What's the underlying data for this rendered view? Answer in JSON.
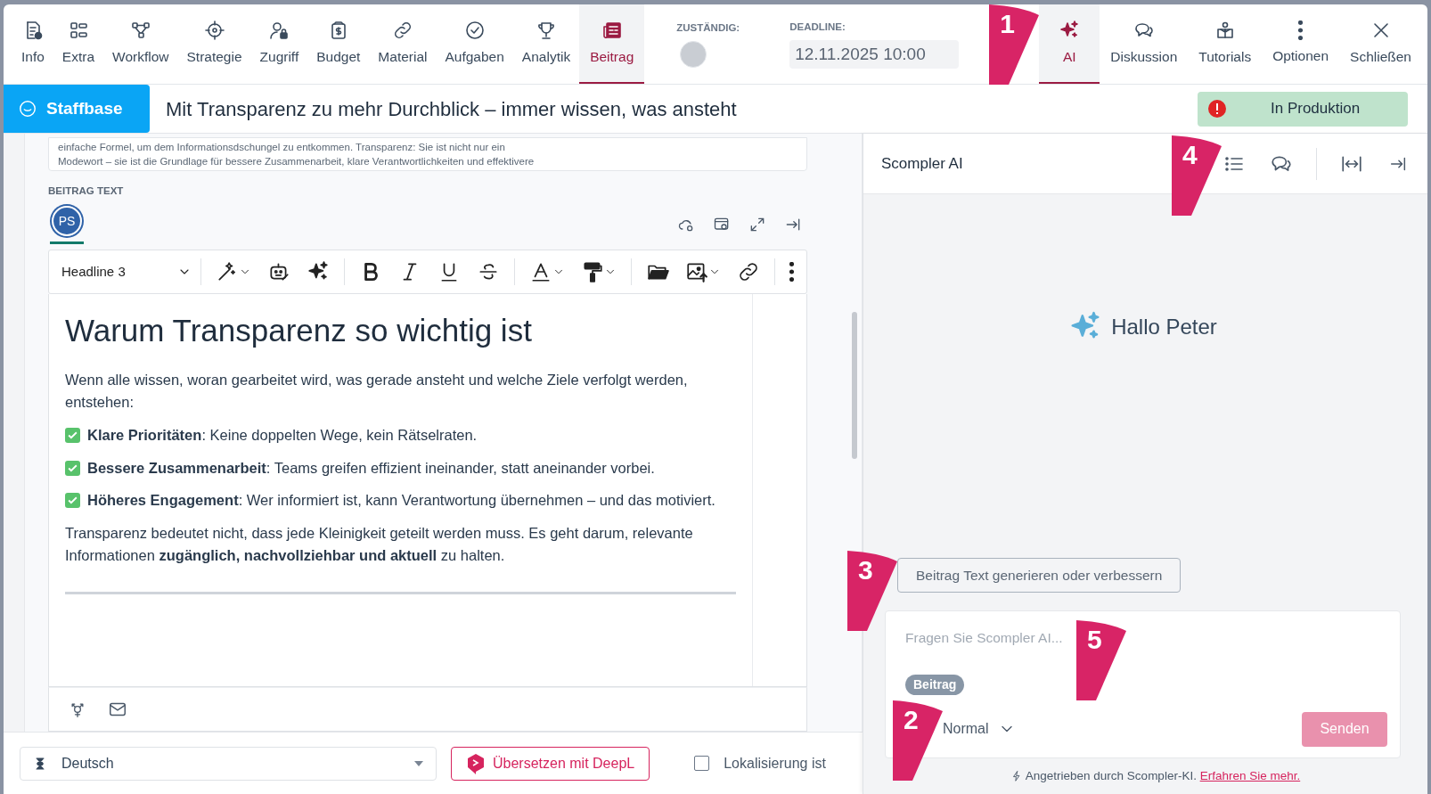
{
  "nav_tabs": [
    {
      "label": "Info",
      "selected": false
    },
    {
      "label": "Extra",
      "selected": false
    },
    {
      "label": "Workflow",
      "selected": false
    },
    {
      "label": "Strategie",
      "selected": false
    },
    {
      "label": "Zugriff",
      "selected": false
    },
    {
      "label": "Budget",
      "selected": false
    },
    {
      "label": "Material",
      "selected": false
    },
    {
      "label": "Aufgaben",
      "selected": false
    },
    {
      "label": "Analytik",
      "selected": false
    },
    {
      "label": "Beitrag",
      "selected": true
    }
  ],
  "assignee": {
    "label": "ZUSTÄNDIG:"
  },
  "deadline": {
    "label": "DEADLINE:",
    "value": "12.11.2025 10:00"
  },
  "right_tabs": [
    {
      "label": "AI",
      "selected": true
    },
    {
      "label": "Diskussion",
      "selected": false
    },
    {
      "label": "Tutorials",
      "selected": false
    },
    {
      "label": "Optionen",
      "selected": false
    },
    {
      "label": "Schließen",
      "selected": false
    }
  ],
  "brand": "Staffbase",
  "title": "Mit Transparenz zu mehr Durchblick – immer wissen, was ansteht",
  "status": "In Produktion",
  "excerpt_lines": [
    "einfache Formel, um dem Informationsdschungel zu entkommen. Transparenz: Sie ist nicht nur ein",
    "Modewort – sie ist die Grundlage für bessere Zusammenarbeit, klare Verantwortlichkeiten und effektivere"
  ],
  "editor": {
    "label": "BEITRAG TEXT",
    "avatar": "PS",
    "format": "Headline 3",
    "heading": "Warum Transparenz so wichtig ist",
    "intro": "Wenn alle wissen, woran gearbeitet wird, was gerade ansteht und welche Ziele verfolgt werden, entstehen:",
    "checklist": [
      {
        "text": "**Klare Prioritäten**: Keine doppelten Wege, kein Rätselraten.",
        "checked": true
      },
      {
        "text": "**Bessere Zusammenarbeit**: Teams greifen effizient ineinander, statt aneinander vorbei.",
        "checked": true
      },
      {
        "text": "**Höheres Engagement**: Wer informiert ist, kann Verantwortung übernehmen – und das motiviert.",
        "checked": true
      }
    ],
    "closing": "Transparenz bedeutet nicht, dass jede Kleinigkeit geteilt werden muss. Es geht darum, relevante Informationen **zugänglich, nachvollziehbar und aktuell** zu halten."
  },
  "footer": {
    "language": "Deutsch",
    "translate_button": "Übersetzen mit DeepL",
    "localization": {
      "label": "Lokalisierung ist",
      "checked": false
    }
  },
  "ai_panel": {
    "title": "Scompler AI",
    "greeting": "Hallo Peter",
    "suggestion": "Beitrag Text generieren oder verbessern",
    "placeholder": "Fragen Sie Scompler AI...",
    "tag": "Beitrag",
    "mode": "Normal",
    "send": "Senden",
    "send_disabled": true,
    "powered": "Angetrieben durch Scompler-KI.",
    "link": "Erfahren Sie mehr."
  },
  "callouts": [
    "1",
    "2",
    "3",
    "4",
    "5"
  ]
}
